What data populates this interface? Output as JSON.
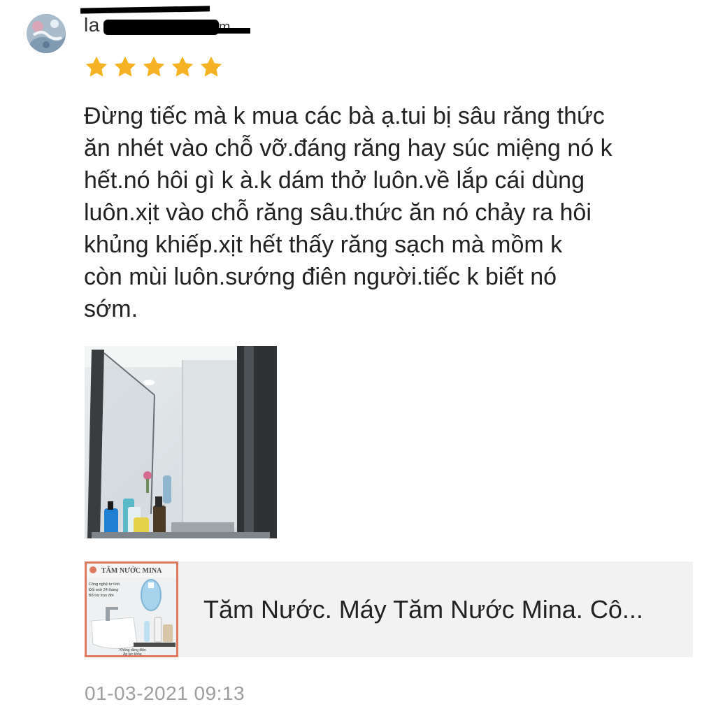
{
  "review": {
    "username_visible": "la",
    "username_obscured_tail": "m",
    "rating": 5,
    "rating_max": 5,
    "star_color": "#f5b323",
    "text": "Đừng tiếc mà k mua các bà ạ.tui bị sâu răng thức\năn nhét vào chỗ vỡ.đáng răng hay súc miệng nó k\nhết.nó hôi gì k à.k dám thở luôn.về lắp cái dùng\nluôn.xịt vào chỗ răng sâu.thức ăn nó chảy ra hôi\nkhủng khiếp.xịt hết thấy răng sạch mà mồm k\ncòn mùi luôn.sướng điên người.tiếc k biết nó\nsớm.",
    "timestamp": "01-03-2021 09:13"
  },
  "product": {
    "title": "Tăm Nước. Máy Tăm Nước Mina. Cô...",
    "thumb_brand": "TĂM NƯỚC MINA",
    "thumb_lines": [
      "Công nghệ tự tính",
      "Đổi mới 24 tháng",
      "Bổ trợ trọn đời"
    ],
    "thumb_footer": [
      "Không dùng điện",
      "Áp lực khỏe"
    ],
    "thumb_border_color": "#e07a5f"
  },
  "icons": {
    "avatar": "user-avatar-icon",
    "star": "star-icon"
  }
}
